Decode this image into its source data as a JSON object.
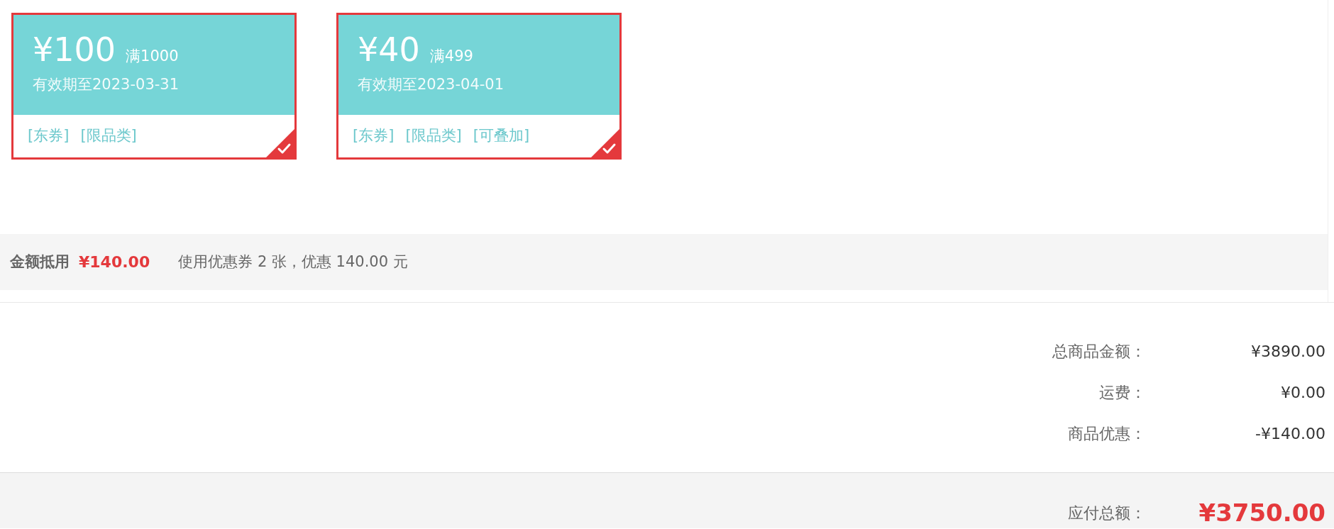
{
  "coupons": [
    {
      "amount": "¥100",
      "threshold": "满1000",
      "validity": "有效期至2023-03-31",
      "tags": [
        "[东券]",
        "[限品类]"
      ],
      "selected": true
    },
    {
      "amount": "¥40",
      "threshold": "满499",
      "validity": "有效期至2023-04-01",
      "tags": [
        "[东券]",
        "[限品类]",
        "[可叠加]"
      ],
      "selected": true
    }
  ],
  "discount_bar": {
    "label": "金额抵用",
    "amount": "¥140.00",
    "summary": "使用优惠券 2 张，优惠 140.00 元"
  },
  "totals": [
    {
      "label": "总商品金额：",
      "value": "¥3890.00"
    },
    {
      "label": "运费：",
      "value": "¥0.00"
    },
    {
      "label": "商品优惠：",
      "value": "-¥140.00"
    }
  ],
  "payable": {
    "label": "应付总额：",
    "value": "¥3750.00"
  }
}
